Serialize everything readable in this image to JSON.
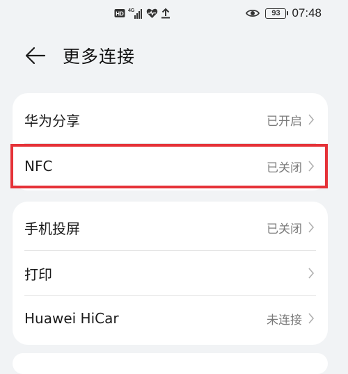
{
  "status_bar": {
    "hd_label": "HD",
    "network_label": "4G",
    "battery_level": "93",
    "time": "07:48",
    "icons": [
      "hd-icon",
      "signal-icon",
      "heart-icon",
      "upload-icon",
      "eye-icon",
      "battery-icon"
    ]
  },
  "header": {
    "back_icon": "back-arrow-icon",
    "title": "更多连接"
  },
  "group1": {
    "items": [
      {
        "label": "华为分享",
        "value": "已开启"
      },
      {
        "label": "NFC",
        "value": "已关闭"
      }
    ]
  },
  "group2": {
    "items": [
      {
        "label": "手机投屏",
        "value": "已关闭"
      },
      {
        "label": "打印",
        "value": ""
      },
      {
        "label": "Huawei HiCar",
        "value": "未连接"
      }
    ]
  },
  "colors": {
    "background": "#f1f3f5",
    "card": "#ffffff",
    "highlight": "#e53238",
    "secondary_text": "#7a7a7a"
  }
}
